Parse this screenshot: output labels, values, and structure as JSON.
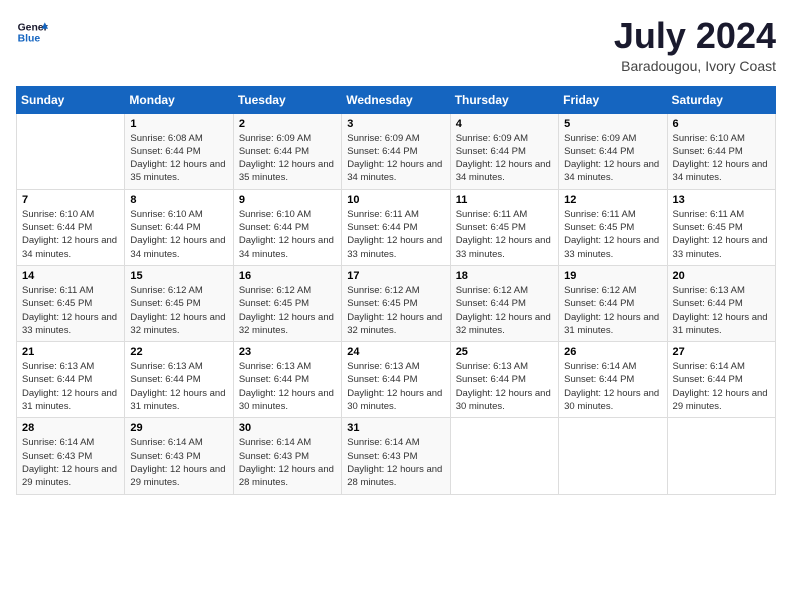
{
  "logo": {
    "line1": "General",
    "line2": "Blue"
  },
  "title": {
    "month_year": "July 2024",
    "location": "Baradougou, Ivory Coast"
  },
  "days_header": [
    "Sunday",
    "Monday",
    "Tuesday",
    "Wednesday",
    "Thursday",
    "Friday",
    "Saturday"
  ],
  "weeks": [
    [
      {
        "day": "",
        "sunrise": "",
        "sunset": "",
        "daylight": ""
      },
      {
        "day": "1",
        "sunrise": "Sunrise: 6:08 AM",
        "sunset": "Sunset: 6:44 PM",
        "daylight": "Daylight: 12 hours and 35 minutes."
      },
      {
        "day": "2",
        "sunrise": "Sunrise: 6:09 AM",
        "sunset": "Sunset: 6:44 PM",
        "daylight": "Daylight: 12 hours and 35 minutes."
      },
      {
        "day": "3",
        "sunrise": "Sunrise: 6:09 AM",
        "sunset": "Sunset: 6:44 PM",
        "daylight": "Daylight: 12 hours and 34 minutes."
      },
      {
        "day": "4",
        "sunrise": "Sunrise: 6:09 AM",
        "sunset": "Sunset: 6:44 PM",
        "daylight": "Daylight: 12 hours and 34 minutes."
      },
      {
        "day": "5",
        "sunrise": "Sunrise: 6:09 AM",
        "sunset": "Sunset: 6:44 PM",
        "daylight": "Daylight: 12 hours and 34 minutes."
      },
      {
        "day": "6",
        "sunrise": "Sunrise: 6:10 AM",
        "sunset": "Sunset: 6:44 PM",
        "daylight": "Daylight: 12 hours and 34 minutes."
      }
    ],
    [
      {
        "day": "7",
        "sunrise": "Sunrise: 6:10 AM",
        "sunset": "Sunset: 6:44 PM",
        "daylight": "Daylight: 12 hours and 34 minutes."
      },
      {
        "day": "8",
        "sunrise": "Sunrise: 6:10 AM",
        "sunset": "Sunset: 6:44 PM",
        "daylight": "Daylight: 12 hours and 34 minutes."
      },
      {
        "day": "9",
        "sunrise": "Sunrise: 6:10 AM",
        "sunset": "Sunset: 6:44 PM",
        "daylight": "Daylight: 12 hours and 34 minutes."
      },
      {
        "day": "10",
        "sunrise": "Sunrise: 6:11 AM",
        "sunset": "Sunset: 6:44 PM",
        "daylight": "Daylight: 12 hours and 33 minutes."
      },
      {
        "day": "11",
        "sunrise": "Sunrise: 6:11 AM",
        "sunset": "Sunset: 6:45 PM",
        "daylight": "Daylight: 12 hours and 33 minutes."
      },
      {
        "day": "12",
        "sunrise": "Sunrise: 6:11 AM",
        "sunset": "Sunset: 6:45 PM",
        "daylight": "Daylight: 12 hours and 33 minutes."
      },
      {
        "day": "13",
        "sunrise": "Sunrise: 6:11 AM",
        "sunset": "Sunset: 6:45 PM",
        "daylight": "Daylight: 12 hours and 33 minutes."
      }
    ],
    [
      {
        "day": "14",
        "sunrise": "Sunrise: 6:11 AM",
        "sunset": "Sunset: 6:45 PM",
        "daylight": "Daylight: 12 hours and 33 minutes."
      },
      {
        "day": "15",
        "sunrise": "Sunrise: 6:12 AM",
        "sunset": "Sunset: 6:45 PM",
        "daylight": "Daylight: 12 hours and 32 minutes."
      },
      {
        "day": "16",
        "sunrise": "Sunrise: 6:12 AM",
        "sunset": "Sunset: 6:45 PM",
        "daylight": "Daylight: 12 hours and 32 minutes."
      },
      {
        "day": "17",
        "sunrise": "Sunrise: 6:12 AM",
        "sunset": "Sunset: 6:45 PM",
        "daylight": "Daylight: 12 hours and 32 minutes."
      },
      {
        "day": "18",
        "sunrise": "Sunrise: 6:12 AM",
        "sunset": "Sunset: 6:44 PM",
        "daylight": "Daylight: 12 hours and 32 minutes."
      },
      {
        "day": "19",
        "sunrise": "Sunrise: 6:12 AM",
        "sunset": "Sunset: 6:44 PM",
        "daylight": "Daylight: 12 hours and 31 minutes."
      },
      {
        "day": "20",
        "sunrise": "Sunrise: 6:13 AM",
        "sunset": "Sunset: 6:44 PM",
        "daylight": "Daylight: 12 hours and 31 minutes."
      }
    ],
    [
      {
        "day": "21",
        "sunrise": "Sunrise: 6:13 AM",
        "sunset": "Sunset: 6:44 PM",
        "daylight": "Daylight: 12 hours and 31 minutes."
      },
      {
        "day": "22",
        "sunrise": "Sunrise: 6:13 AM",
        "sunset": "Sunset: 6:44 PM",
        "daylight": "Daylight: 12 hours and 31 minutes."
      },
      {
        "day": "23",
        "sunrise": "Sunrise: 6:13 AM",
        "sunset": "Sunset: 6:44 PM",
        "daylight": "Daylight: 12 hours and 30 minutes."
      },
      {
        "day": "24",
        "sunrise": "Sunrise: 6:13 AM",
        "sunset": "Sunset: 6:44 PM",
        "daylight": "Daylight: 12 hours and 30 minutes."
      },
      {
        "day": "25",
        "sunrise": "Sunrise: 6:13 AM",
        "sunset": "Sunset: 6:44 PM",
        "daylight": "Daylight: 12 hours and 30 minutes."
      },
      {
        "day": "26",
        "sunrise": "Sunrise: 6:14 AM",
        "sunset": "Sunset: 6:44 PM",
        "daylight": "Daylight: 12 hours and 30 minutes."
      },
      {
        "day": "27",
        "sunrise": "Sunrise: 6:14 AM",
        "sunset": "Sunset: 6:44 PM",
        "daylight": "Daylight: 12 hours and 29 minutes."
      }
    ],
    [
      {
        "day": "28",
        "sunrise": "Sunrise: 6:14 AM",
        "sunset": "Sunset: 6:43 PM",
        "daylight": "Daylight: 12 hours and 29 minutes."
      },
      {
        "day": "29",
        "sunrise": "Sunrise: 6:14 AM",
        "sunset": "Sunset: 6:43 PM",
        "daylight": "Daylight: 12 hours and 29 minutes."
      },
      {
        "day": "30",
        "sunrise": "Sunrise: 6:14 AM",
        "sunset": "Sunset: 6:43 PM",
        "daylight": "Daylight: 12 hours and 28 minutes."
      },
      {
        "day": "31",
        "sunrise": "Sunrise: 6:14 AM",
        "sunset": "Sunset: 6:43 PM",
        "daylight": "Daylight: 12 hours and 28 minutes."
      },
      {
        "day": "",
        "sunrise": "",
        "sunset": "",
        "daylight": ""
      },
      {
        "day": "",
        "sunrise": "",
        "sunset": "",
        "daylight": ""
      },
      {
        "day": "",
        "sunrise": "",
        "sunset": "",
        "daylight": ""
      }
    ]
  ]
}
